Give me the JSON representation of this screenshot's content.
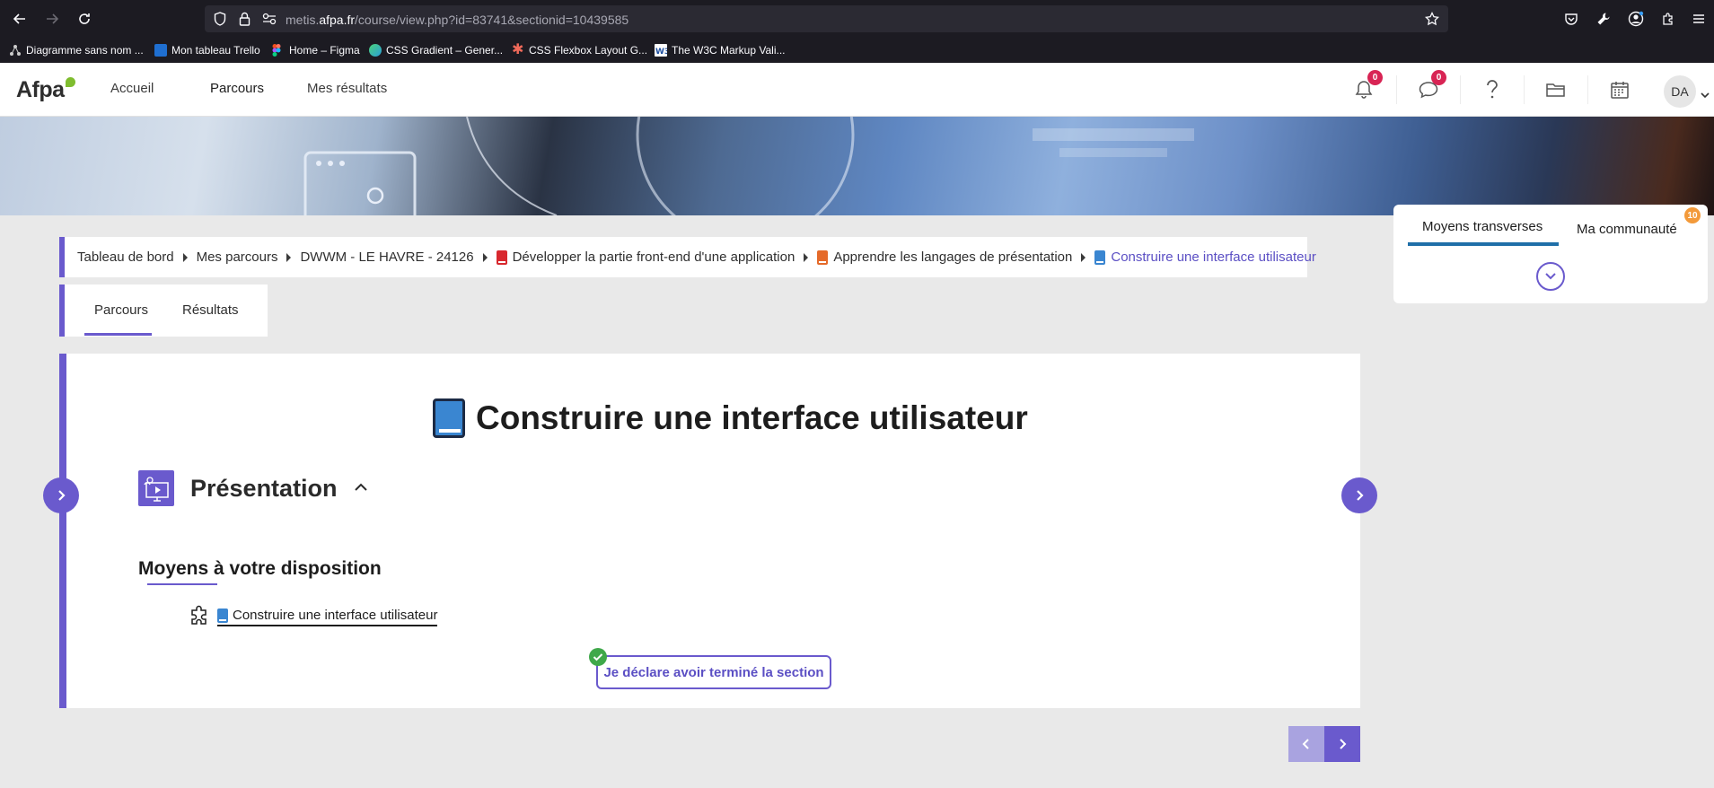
{
  "browser": {
    "url_prefix": "metis.",
    "url_domain": "afpa.fr",
    "url_rest": "/course/view.php?id=83741&sectionid=10439585",
    "bookmarks": [
      "Diagramme sans nom ...",
      "Mon tableau Trello",
      "Home – Figma",
      "CSS Gradient – Gener...",
      "CSS Flexbox Layout G...",
      "The W3C Markup Vali..."
    ]
  },
  "nav": {
    "logo": "Afpa",
    "links": [
      "Accueil",
      "Parcours",
      "Mes résultats"
    ],
    "notifications_count": "0",
    "messages_count": "0",
    "avatar_initials": "DA"
  },
  "breadcrumb": [
    "Tableau de bord",
    "Mes parcours",
    "DWWM - LE HAVRE - 24126",
    "Développer la partie front-end d'une application",
    "Apprendre les langages de présentation",
    "Construire une interface utilisateur"
  ],
  "tabs": [
    "Parcours",
    "Résultats"
  ],
  "card": {
    "title": "Construire une interface utilisateur",
    "section_title": "Présentation",
    "subhead": "Moyens à votre disposition",
    "resource_label": "Construire une interface utilisateur",
    "done_button": "Je déclare avoir terminé la section"
  },
  "right_panel": {
    "tab1": "Moyens transverses",
    "tab2": "Ma communauté",
    "community_count": "10"
  },
  "colors": {
    "accent": "#6a5acd",
    "badge_red": "#d82454",
    "badge_orange": "#f39a3a",
    "tab_blue": "#1f6fa8"
  }
}
